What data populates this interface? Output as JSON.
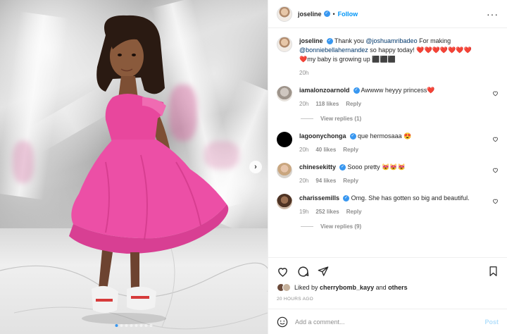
{
  "header": {
    "username": "joseline",
    "separator": "•",
    "follow_label": "Follow",
    "more_label": "···"
  },
  "media": {
    "next_label": "›",
    "dots_count": 8,
    "active_dot": 0
  },
  "caption": {
    "username": "joseline",
    "text_1": "Thank you ",
    "mention_1": "@joshuamribadeo",
    "text_2": " For making ",
    "mention_2": "@bonniebellahernandez",
    "text_3": " so happy today! ❤️❤️❤️❤️❤️❤️❤️",
    "text_4": "❤️my baby is growing up ⬛⬛⬛",
    "time": "20h"
  },
  "comments": [
    {
      "username": "iamalonzoarnold",
      "text": "Awwww heyyy princess❤️",
      "time": "20h",
      "likes": "118 likes",
      "reply": "Reply",
      "view_replies": "View replies (1)"
    },
    {
      "username": "lagoonychonga",
      "text": "que hermosaaa 😍",
      "time": "20h",
      "likes": "40 likes",
      "reply": "Reply",
      "view_replies": ""
    },
    {
      "username": "chinesekitty",
      "text": "Sooo pretty 😻😻😻",
      "time": "20h",
      "likes": "94 likes",
      "reply": "Reply",
      "view_replies": ""
    },
    {
      "username": "charissemills",
      "text": "Omg. She has gotten so big and beautiful.",
      "time": "19h",
      "likes": "252 likes",
      "reply": "Reply",
      "view_replies": "View replies (9)"
    }
  ],
  "liked_by": {
    "prefix": "Liked by ",
    "user": "cherrybomb_kayy",
    "middle": " and ",
    "others": "others"
  },
  "time_ago": "20 HOURS AGO",
  "add_comment": {
    "placeholder": "Add a comment...",
    "post_label": "Post"
  },
  "colors": {
    "accent": "#0095f6",
    "verified": "#3897f0",
    "heart": "#ed4956",
    "dress_pink": "#ec4fa6"
  },
  "icons": [
    "heart-icon",
    "comment-icon",
    "share-icon",
    "bookmark-icon",
    "emoji-icon",
    "more-icon",
    "verified-icon",
    "chevron-right-icon"
  ]
}
